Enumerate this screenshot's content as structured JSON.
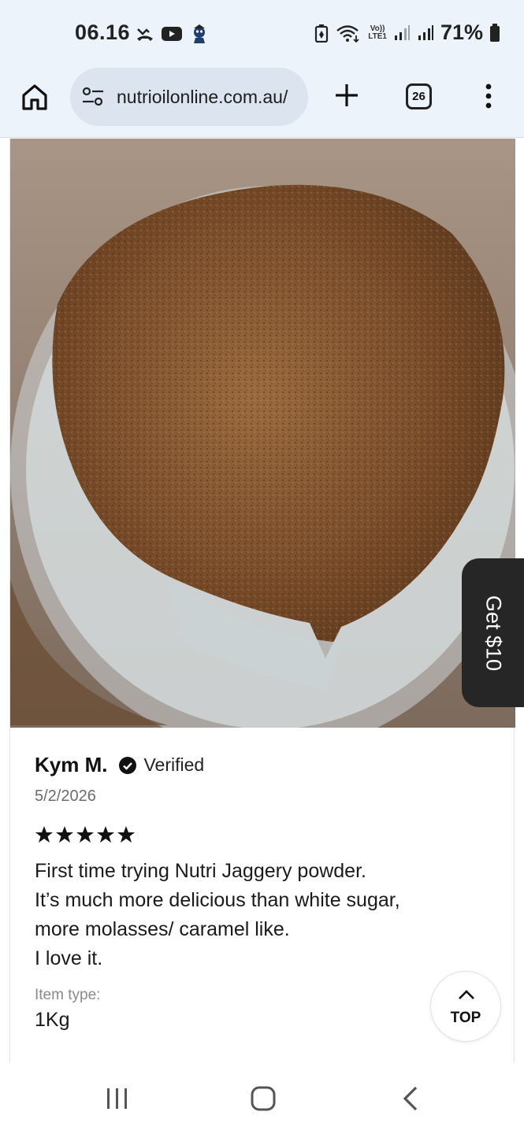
{
  "status_bar": {
    "time": "06.16",
    "battery_percent": "71%",
    "network_label_top": "Vo))",
    "network_label_bottom": "LTE1",
    "icons_left": [
      "missed-call-icon",
      "youtube-icon",
      "app-notification-icon"
    ],
    "icons_right": [
      "battery-saver-icon",
      "wifi-icon",
      "signal-1-icon",
      "signal-2-icon",
      "battery-icon"
    ]
  },
  "browser": {
    "url": "nutrioilonline.com.au/",
    "tab_count": "26"
  },
  "review": {
    "photo_alt": "jar of jaggery powder",
    "reviewer_name": "Kym M.",
    "verified_label": "Verified",
    "date": "5/2/2026",
    "rating": 5,
    "body_lines": [
      "First time trying Nutri Jaggery powder.",
      "It’s much more delicious than white sugar,",
      "more molasses/ caramel like.",
      "I love it."
    ],
    "item_type_label": "Item type:",
    "item_type_value": "1Kg"
  },
  "floating": {
    "promo_label": "Get $10",
    "top_label": "TOP"
  },
  "colors": {
    "chrome_bg": "#edf3fa",
    "url_pill": "#dbe4ef",
    "promo_bg": "#262626",
    "jaggery": "#8a5a34"
  }
}
